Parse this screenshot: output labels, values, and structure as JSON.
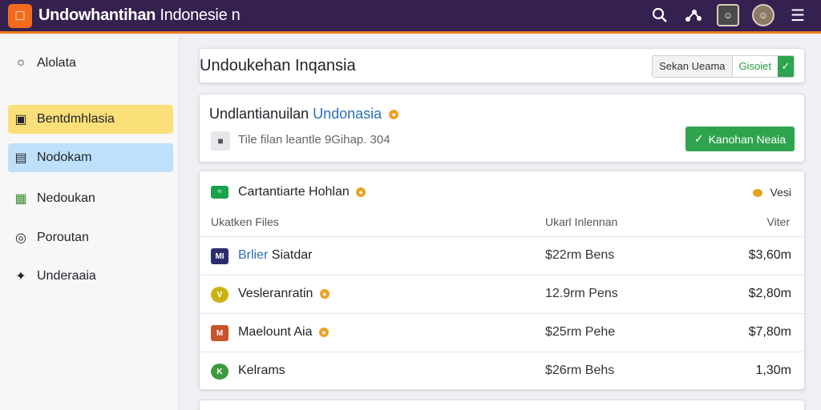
{
  "header": {
    "app_title": "Undowhantihan",
    "app_title_suffix": "Indonesie n",
    "icons": [
      "search-icon",
      "share-icon",
      "avatar",
      "avatar",
      "menu-icon"
    ]
  },
  "sidebar": {
    "items": [
      {
        "label": "Alolata",
        "icon": "circle-icon"
      },
      {
        "label": "Bentdmhlasia",
        "icon": "doc-icon"
      },
      {
        "label": "Nodokam",
        "icon": "doc-icon"
      },
      {
        "label": "Nedoukan",
        "icon": "doc-icon"
      },
      {
        "label": "Poroutan",
        "icon": "target-icon"
      },
      {
        "label": "Underaaia",
        "icon": "tree-icon"
      }
    ]
  },
  "main": {
    "page_title": "Undoukehan Inqansia",
    "segment": {
      "left": "Sekan Ueama",
      "middle": "Gisoiet"
    },
    "info_card": {
      "title_prefix": "Undlantianuilan",
      "title_highlight": "Undonasia",
      "subtitle": "Tile filan leantle 9Gihap. 304",
      "button_label": "Kanohan Neaia"
    },
    "table_card": {
      "title": "Cartantiarte Hohlan",
      "right_label": "Vesi",
      "columns": [
        "Ukatken Files",
        "Ukarl Inlennan",
        "Viter"
      ],
      "rows": [
        {
          "name_highlight": "Brlier",
          "name": "Siatdar",
          "mid": "$22rm Bens",
          "value": "$3,60m",
          "icon_color": "#2b2d6e",
          "icon_text": "MI"
        },
        {
          "name_highlight": "",
          "name": "Vesleranratin",
          "mid": "12.9rm Pens",
          "value": "$2,80m",
          "icon_color": "#c9b312",
          "icon_text": "V"
        },
        {
          "name_highlight": "",
          "name": "Maelount Aia",
          "mid": "$25rm Pehe",
          "value": "$7,80m",
          "icon_color": "#c8522a",
          "icon_text": "M"
        },
        {
          "name_highlight": "",
          "name": "Kelrams",
          "mid": "$26rm Behs",
          "value": "1,30m",
          "icon_color": "#3b9a3e",
          "icon_text": "K"
        }
      ]
    }
  }
}
